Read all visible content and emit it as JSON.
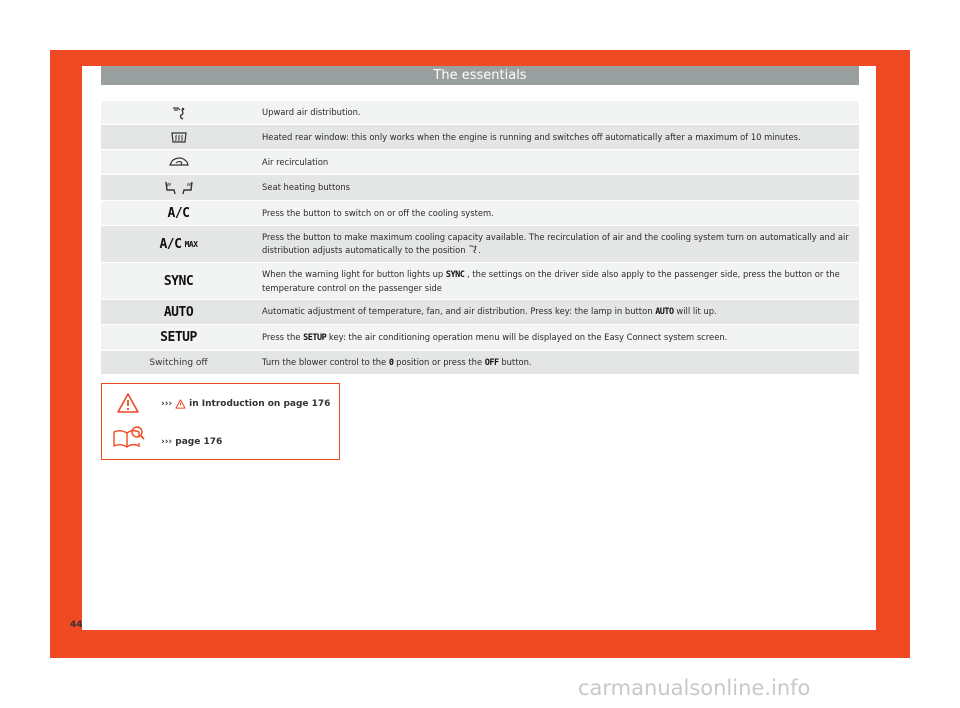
{
  "header": {
    "title": "The essentials"
  },
  "rows": [
    {
      "icon": "upward-air-distribution-icon",
      "text": "Upward air distribution."
    },
    {
      "icon": "heated-rear-window-icon",
      "text": "Heated rear window: this only works when the engine is running and switches off automatically after a maximum of 10 minutes."
    },
    {
      "icon": "air-recirculation-icon",
      "text": "Air recirculation"
    },
    {
      "icon": "seat-heating-icon",
      "text": "Seat heating buttons"
    },
    {
      "key": "A/C",
      "text": "Press the button to switch on or off the cooling system."
    },
    {
      "key": "A/C",
      "key_sup": "MAX",
      "text_before": "Press the button to make maximum cooling capacity available. The recirculation of air and the cooling system turn on automatically and air distribution adjusts automatically to the position",
      "text_after": "."
    },
    {
      "key": "SYNC",
      "text_before": "When the warning light for button lights up",
      "inline_key": "SYNC",
      "text_after": ", the settings on the driver side also apply to the passenger side, press the button or the temperature control on the passenger side"
    },
    {
      "key": "AUTO",
      "text_before": "Automatic adjustment of temperature, fan, and air distribution. Press key: the lamp in button",
      "inline_key": "AUTO",
      "text_after": "will lit up."
    },
    {
      "key": "SETUP",
      "text_before": "Press the",
      "inline_key": "SETUP",
      "text_after": "key: the air conditioning operation menu will be displayed on the Easy Connect system screen."
    },
    {
      "label": "Switching off",
      "text_before": "Turn the blower control to the",
      "inline_key": "0",
      "text_middle": "position or press the",
      "inline_key2": "OFF",
      "text_after": "button."
    }
  ],
  "notes": {
    "warning_prefix": "›››",
    "warning_text": "in Introduction on page 176",
    "book_text": "››› page 176"
  },
  "page_number": "44",
  "watermark": "carmanualsonline.info",
  "colors": {
    "accent": "#f04a24",
    "header_bg": "#9aa09f",
    "row_light": "#f2f3f3",
    "row_dark": "#e4e6e6"
  }
}
